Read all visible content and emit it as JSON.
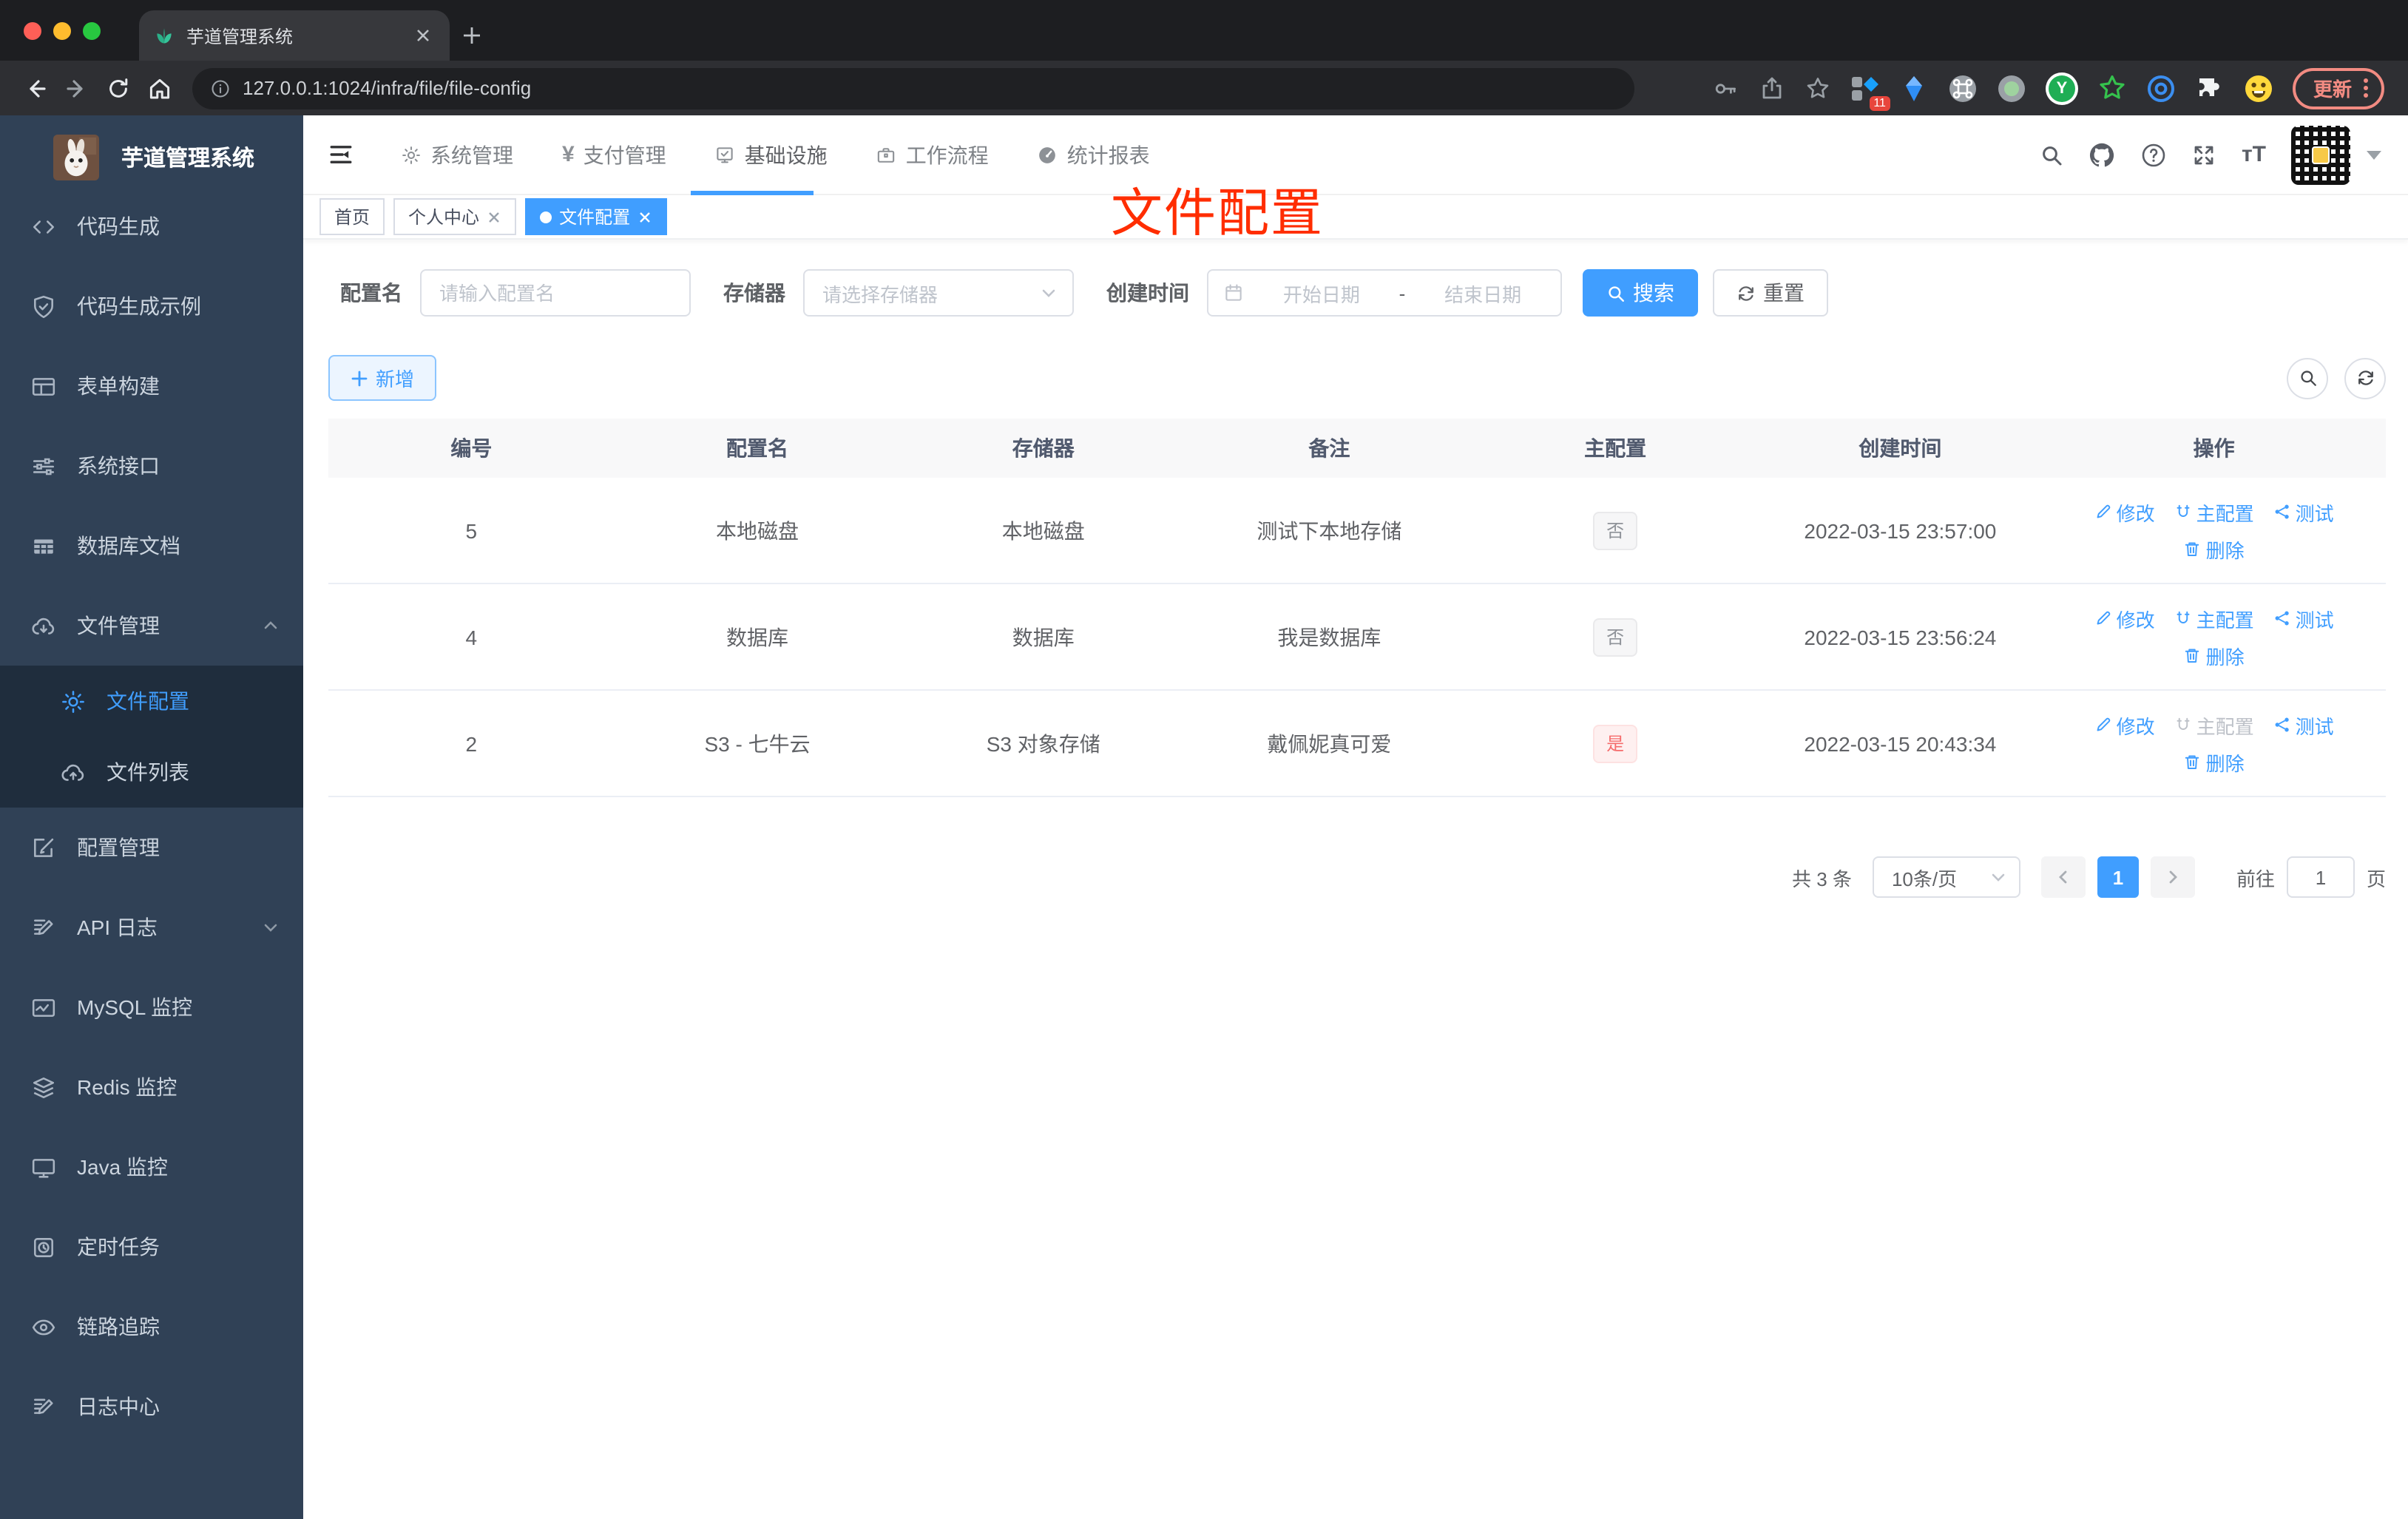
{
  "colors": {
    "primary": "#409eff",
    "danger": "#f56c6c",
    "annotation": "#ff2d00",
    "sidebar_bg": "#304156",
    "submenu_bg": "#1f2d3d"
  },
  "browser": {
    "tab_title": "芋道管理系统",
    "url": "127.0.0.1:1024/infra/file/file-config",
    "extension_badge": "11",
    "update_label": "更新"
  },
  "sidebar": {
    "logo_title": "芋道管理系统",
    "items": [
      {
        "label": "代码生成",
        "icon": "code-icon"
      },
      {
        "label": "代码生成示例",
        "icon": "shield-check-icon"
      },
      {
        "label": "表单构建",
        "icon": "form-icon"
      },
      {
        "label": "系统接口",
        "icon": "sliders-icon"
      },
      {
        "label": "数据库文档",
        "icon": "table-icon"
      },
      {
        "label": "文件管理",
        "icon": "cloud-download-icon"
      },
      {
        "label": "文件配置",
        "icon": "gear-icon"
      },
      {
        "label": "文件列表",
        "icon": "cloud-upload-icon"
      },
      {
        "label": "配置管理",
        "icon": "edit-square-icon"
      },
      {
        "label": "API 日志",
        "icon": "doc-edit-icon"
      },
      {
        "label": "MySQL 监控",
        "icon": "chart-monitor-icon"
      },
      {
        "label": "Redis 监控",
        "icon": "layers-icon"
      },
      {
        "label": "Java 监控",
        "icon": "display-icon"
      },
      {
        "label": "定时任务",
        "icon": "timer-icon"
      },
      {
        "label": "链路追踪",
        "icon": "eye-icon"
      },
      {
        "label": "日志中心",
        "icon": "doc-edit-icon"
      }
    ]
  },
  "topnav": {
    "items": [
      {
        "label": "系统管理",
        "icon": "gear-icon"
      },
      {
        "label": "支付管理",
        "icon": "yen-icon"
      },
      {
        "label": "基础设施",
        "icon": "monitor-check-icon"
      },
      {
        "label": "工作流程",
        "icon": "briefcase-icon"
      },
      {
        "label": "统计报表",
        "icon": "gauge-icon"
      }
    ]
  },
  "tags": {
    "items": [
      {
        "label": "首页"
      },
      {
        "label": "个人中心"
      },
      {
        "label": "文件配置"
      }
    ]
  },
  "annotation": {
    "text": "文件配置"
  },
  "filters": {
    "name_label": "配置名",
    "name_placeholder": "请输入配置名",
    "storage_label": "存储器",
    "storage_placeholder": "请选择存储器",
    "time_label": "创建时间",
    "start_placeholder": "开始日期",
    "separator": "-",
    "end_placeholder": "结束日期",
    "search_label": "搜索",
    "reset_label": "重置"
  },
  "toolbar": {
    "add_label": "新增"
  },
  "table": {
    "headers": [
      "编号",
      "配置名",
      "存储器",
      "备注",
      "主配置",
      "创建时间",
      "操作"
    ],
    "rows": [
      {
        "id": "5",
        "name": "本地磁盘",
        "storage": "本地磁盘",
        "remark": "测试下本地存储",
        "master": "否",
        "time": "2022-03-15 23:57:00"
      },
      {
        "id": "4",
        "name": "数据库",
        "storage": "数据库",
        "remark": "我是数据库",
        "master": "否",
        "time": "2022-03-15 23:56:24"
      },
      {
        "id": "2",
        "name": "S3 - 七牛云",
        "storage": "S3 对象存储",
        "remark": "戴佩妮真可爱",
        "master": "是",
        "time": "2022-03-15 20:43:34"
      }
    ],
    "actions": {
      "edit": "修改",
      "master": "主配置",
      "test": "测试",
      "delete": "删除"
    }
  },
  "pagination": {
    "total": "共 3 条",
    "page_size": "10条/页",
    "page": "1",
    "goto_label": "前往",
    "goto_value": "1",
    "page_unit": "页"
  }
}
